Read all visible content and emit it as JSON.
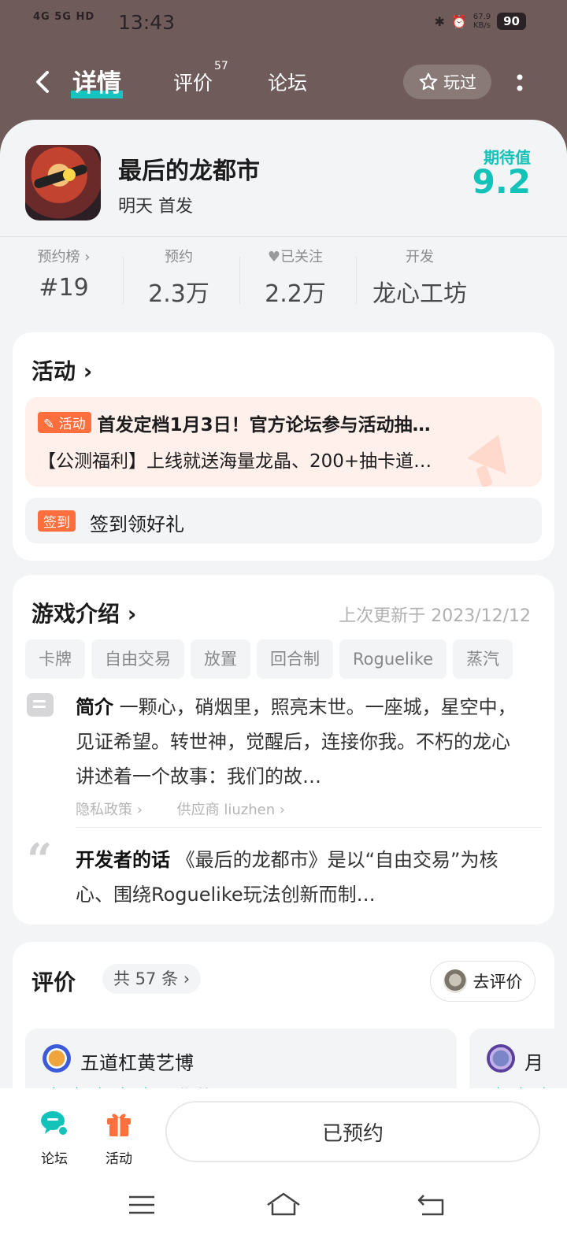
{
  "status_bar": {
    "network": "4G 5G HD",
    "time": "13:43",
    "speed": "67.9\nKB/s",
    "battery": "90"
  },
  "nav": {
    "tabs": [
      {
        "label": "详情",
        "active": true
      },
      {
        "label": "评价",
        "badge": "57"
      },
      {
        "label": "论坛"
      }
    ],
    "played_label": "玩过"
  },
  "game": {
    "title": "最后的龙都市",
    "subtitle": "明天 首发",
    "score_label": "期待值",
    "score": "9.2"
  },
  "stats": [
    {
      "label": "预约榜 ›",
      "value": "#19"
    },
    {
      "label": "预约",
      "value": "2.3万"
    },
    {
      "label": "已关注",
      "value": "2.2万"
    },
    {
      "label": "开发",
      "value": "龙心工坊"
    }
  ],
  "activity": {
    "title": "活动 ›",
    "badge": "活动",
    "line1": "首发定档1月3日！官方论坛参与活动抽…",
    "line2": "【公测福利】上线就送海量龙晶、200+抽卡道…",
    "checkin_badge": "签到",
    "checkin_text": "签到领好礼"
  },
  "intro": {
    "title": "游戏介绍 ›",
    "updated": "上次更新于 2023/12/12",
    "tags": [
      "卡牌",
      "自由交易",
      "放置",
      "回合制",
      "Roguelike",
      "蒸汽"
    ],
    "summary_label": "简介",
    "summary": " 一颗心，硝烟里，照亮末世。一座城，星空中，见证希望。转世神，觉醒后，连接你我。不朽的龙心讲述着一个故事：我们的故…",
    "privacy_link": "隐私政策 ›",
    "supplier_link": "供应商 liuzhen ›",
    "dev_label": "开发者的话",
    "dev_text": " 《最后的龙都市》是以“自由交易”为核心、围绕Roguelike玩法创新而制…"
  },
  "reviews": {
    "title": "评价",
    "count": "共 57 条 ›",
    "go_review": "去评价",
    "items": [
      {
        "name": "五道杠黄艺博",
        "stars": "★★★★★",
        "tag": "期待"
      },
      {
        "name": "月",
        "stars": "★★★",
        "tag": ""
      }
    ]
  },
  "bottom_bar": {
    "forum_label": "论坛",
    "activity_label": "活动",
    "reserve_label": "已预约"
  },
  "colors": {
    "accent": "#13c3b9",
    "orange": "#ff6f3d",
    "header_bg": "#6f5c5a"
  }
}
